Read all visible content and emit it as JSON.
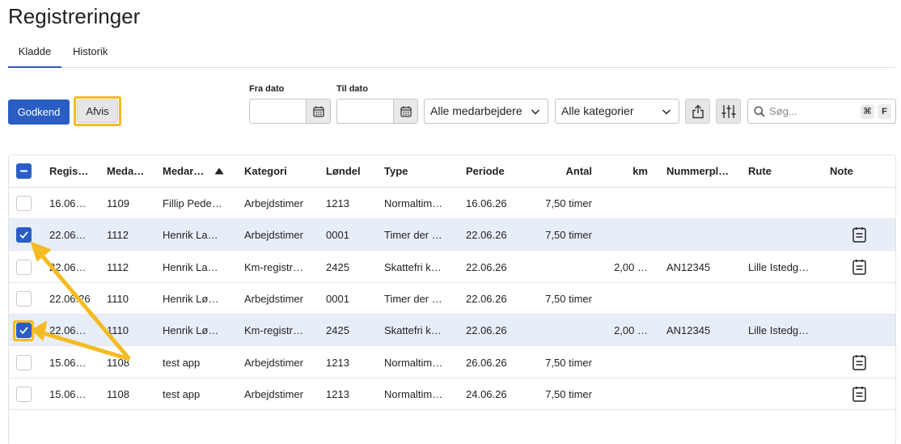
{
  "page": {
    "title": "Registreringer"
  },
  "tabs": [
    {
      "label": "Kladde",
      "active": true
    },
    {
      "label": "Historik",
      "active": false
    }
  ],
  "actions": {
    "approve_label": "Godkend",
    "reject_label": "Afvis"
  },
  "filters": {
    "from_label": "Fra dato",
    "to_label": "Til dato",
    "employees_value": "Alle medarbejdere",
    "categories_value": "Alle kategorier"
  },
  "search": {
    "placeholder": "Søg...",
    "shortcut_key1": "⌘",
    "shortcut_key2": "F"
  },
  "table": {
    "headers": {
      "registered": "Regis…",
      "employee_no": "Meda…",
      "employee": "Medar…",
      "category": "Kategori",
      "wage_type": "Løndel",
      "type": "Type",
      "period": "Periode",
      "amount": "Antal",
      "km": "km",
      "plate": "Nummerpl…",
      "route": "Rute",
      "note": "Note"
    },
    "rows": [
      {
        "registered": "16.06…",
        "employee_no": "1109",
        "employee": "Fillip Pede…",
        "category": "Arbejdstimer",
        "wage_type": "1213",
        "type": "Normaltim…",
        "period": "16.06.26",
        "amount": "7,50 timer",
        "km": "",
        "plate": "",
        "route": "",
        "note": false,
        "checked": false
      },
      {
        "registered": "22.06…",
        "employee_no": "1112",
        "employee": "Henrik La…",
        "category": "Arbejdstimer",
        "wage_type": "0001",
        "type": "Timer der …",
        "period": "22.06.26",
        "amount": "7,50 timer",
        "km": "",
        "plate": "",
        "route": "",
        "note": true,
        "checked": true
      },
      {
        "registered": "22.06…",
        "employee_no": "1112",
        "employee": "Henrik La…",
        "category": "Km-registr…",
        "wage_type": "2425",
        "type": "Skattefri k…",
        "period": "22.06.26",
        "amount": "",
        "km": "2,00 …",
        "plate": "AN12345",
        "route": "Lille Istedg…",
        "note": true,
        "checked": false
      },
      {
        "registered": "22.06.26",
        "employee_no": "1110",
        "employee": "Henrik Lø…",
        "category": "Arbejdstimer",
        "wage_type": "0001",
        "type": "Timer der …",
        "period": "22.06.26",
        "amount": "7,50 timer",
        "km": "",
        "plate": "",
        "route": "",
        "note": false,
        "checked": false
      },
      {
        "registered": "22.06…",
        "employee_no": "1110",
        "employee": "Henrik Lø…",
        "category": "Km-registr…",
        "wage_type": "2425",
        "type": "Skattefri k…",
        "period": "22.06.26",
        "amount": "",
        "km": "2,00 …",
        "plate": "AN12345",
        "route": "Lille Istedg…",
        "note": false,
        "checked": true
      },
      {
        "registered": "15.06…",
        "employee_no": "1108",
        "employee": "test app",
        "category": "Arbejdstimer",
        "wage_type": "1213",
        "type": "Normaltim…",
        "period": "26.06.26",
        "amount": "7,50 timer",
        "km": "",
        "plate": "",
        "route": "",
        "note": true,
        "checked": false
      },
      {
        "registered": "15.06…",
        "employee_no": "1108",
        "employee": "test app",
        "category": "Arbejdstimer",
        "wage_type": "1213",
        "type": "Normaltim…",
        "period": "24.06.26",
        "amount": "7,50 timer",
        "km": "",
        "plate": "",
        "route": "",
        "note": true,
        "checked": false
      }
    ]
  },
  "colors": {
    "primary": "#2a5ec4",
    "highlight": "#f4bb22",
    "selected_row": "#e8eef8"
  },
  "icons": [
    "calendar-icon",
    "chevron-down-icon",
    "share-icon",
    "sliders-icon",
    "search-icon",
    "note-icon",
    "sort-asc-icon",
    "check-icon",
    "minus-icon"
  ]
}
